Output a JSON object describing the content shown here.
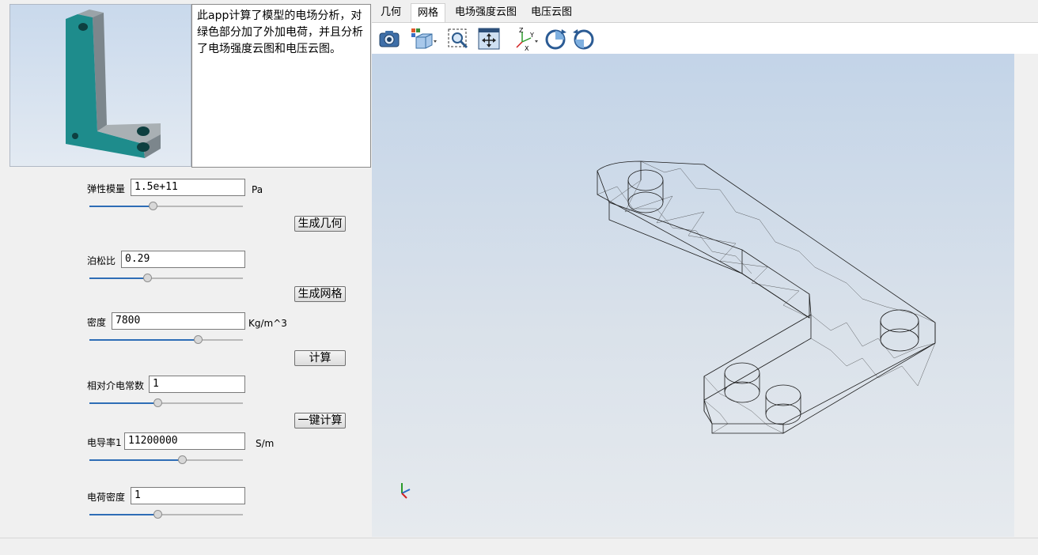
{
  "description": "此app计算了模型的电场分析，对绿色部分加了外加电荷，并且分析了电场强度云图和电压云图。",
  "params": [
    {
      "label": "弹性模量",
      "value": "1.5e+11",
      "unit": "Pa",
      "level": 0.42
    },
    {
      "label": "泊松比",
      "value": "0.29",
      "unit": "",
      "level": 0.38
    },
    {
      "label": "密度",
      "value": "7800",
      "unit": "Kg/m^3",
      "level": 0.71
    },
    {
      "label": "相对介电常数",
      "value": "1",
      "unit": "",
      "level": 0.45
    },
    {
      "label": "电导率1",
      "value": "11200000",
      "unit": "S/m",
      "level": 0.61
    },
    {
      "label": "电荷密度",
      "value": "1",
      "unit": "",
      "level": 0.45
    }
  ],
  "buttons": {
    "gen_geometry": "生成几何",
    "gen_mesh": "生成网格",
    "compute": "计算",
    "one_click": "一键计算"
  },
  "tabs": [
    "几何",
    "网格",
    "电场强度云图",
    "电压云图"
  ],
  "active_tab": 1,
  "toolbar_icons": [
    "camera-icon",
    "view-cube-icon",
    "zoom-box-icon",
    "zoom-extents-icon",
    "axis-triad-icon",
    "rotate-cw-icon",
    "rotate-ccw-icon"
  ],
  "triad_labels": {
    "x": "X",
    "y": "Y",
    "z": "Z"
  },
  "colors": {
    "slider_fill": "#2e6db6",
    "mesh_line": "#1a1a1a",
    "model_teal": "#1e8c8c"
  }
}
